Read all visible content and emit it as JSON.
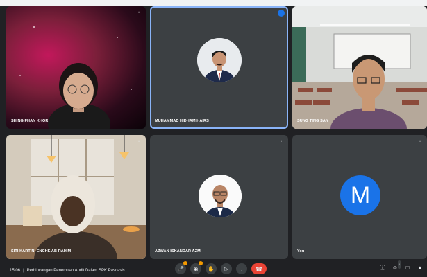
{
  "participants": [
    {
      "name": "SHING FHAN KHOR",
      "mic": "•"
    },
    {
      "name": "MUHAMMAD HIDHAM HAIRS",
      "mic": "…"
    },
    {
      "name": "SUNG TING SAN",
      "mic": "•"
    },
    {
      "name": "SITI KARTINI ENCHE AB RAHIM",
      "mic": "•"
    },
    {
      "name": "AZWAN ISKANDAR AZMI",
      "mic": "•"
    },
    {
      "name": "You",
      "initial": "M",
      "mic": "•"
    }
  ],
  "footer": {
    "time": "15:06",
    "meeting_title": "Perbincangan Penemuan Audit Dalam SPK Pascasis..."
  },
  "people_count": "6",
  "colors": {
    "background": "#202124",
    "tile": "#3c4043",
    "active_border": "#8ab4f8",
    "avatar_you": "#1a73e8",
    "end_call": "#ea4335",
    "reaction": "#f29900"
  }
}
